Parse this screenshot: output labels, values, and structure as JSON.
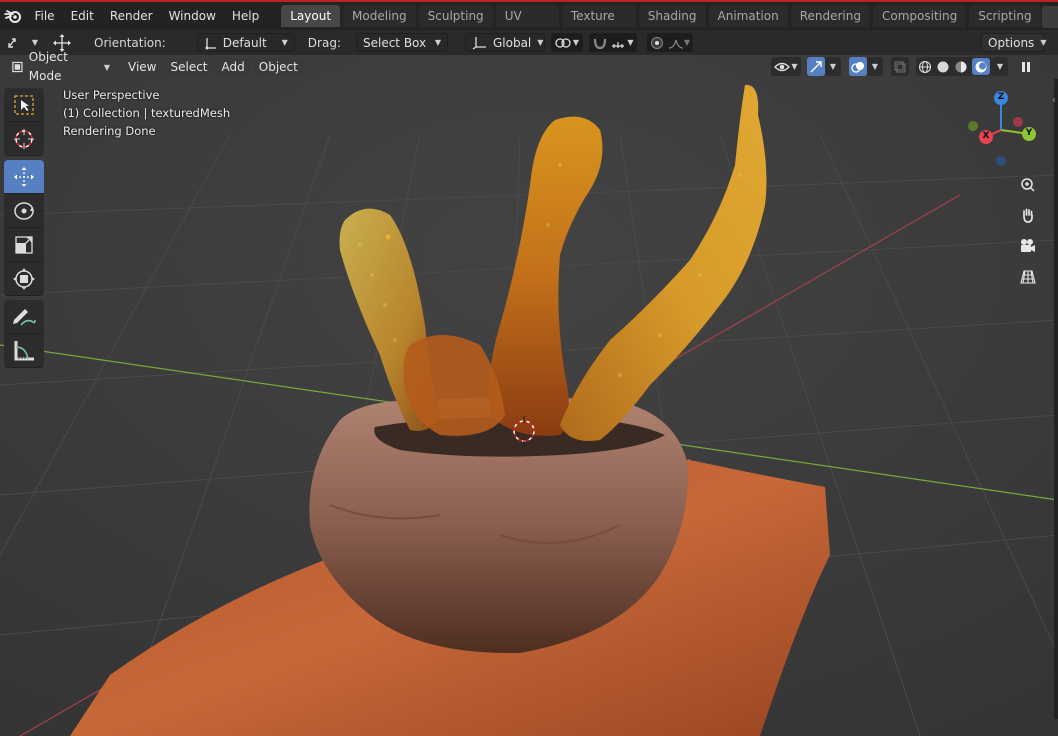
{
  "menu": {
    "items": [
      "File",
      "Edit",
      "Render",
      "Window",
      "Help"
    ]
  },
  "workspaces": {
    "tabs": [
      "Layout",
      "Modeling",
      "Sculpting",
      "UV Editing",
      "Texture Paint",
      "Shading",
      "Animation",
      "Rendering",
      "Compositing",
      "Scripting"
    ],
    "add": "+"
  },
  "tool_header": {
    "orientation_label": "Orientation:",
    "orientation_value": "Default",
    "drag_label": "Drag:",
    "drag_value": "Select Box",
    "transform_orientation": "Global",
    "options": "Options"
  },
  "viewport_header": {
    "mode": "Object Mode",
    "view": "View",
    "select": "Select",
    "add": "Add",
    "object": "Object"
  },
  "overlay": {
    "perspective": "User Perspective",
    "collection": "(1) Collection | texturedMesh",
    "status": "Rendering Done"
  },
  "gizmo": {
    "z": "Z",
    "y": "Y",
    "x": "X"
  },
  "colors": {
    "accent": "#5680c2",
    "axis_x": "#e8424f",
    "axis_y": "#8ec534",
    "axis_z": "#3b87e0",
    "top_bar": "#232323",
    "viewport": "#3a3a3a"
  },
  "icons": {
    "tools": [
      "select-box-icon",
      "cursor-icon",
      "move-icon",
      "rotate-icon",
      "scale-icon",
      "transform-icon",
      "annotate-icon",
      "measure-icon"
    ],
    "nav": [
      "zoom-icon",
      "hand-pan-icon",
      "camera-icon",
      "grid-ortho-icon"
    ]
  }
}
